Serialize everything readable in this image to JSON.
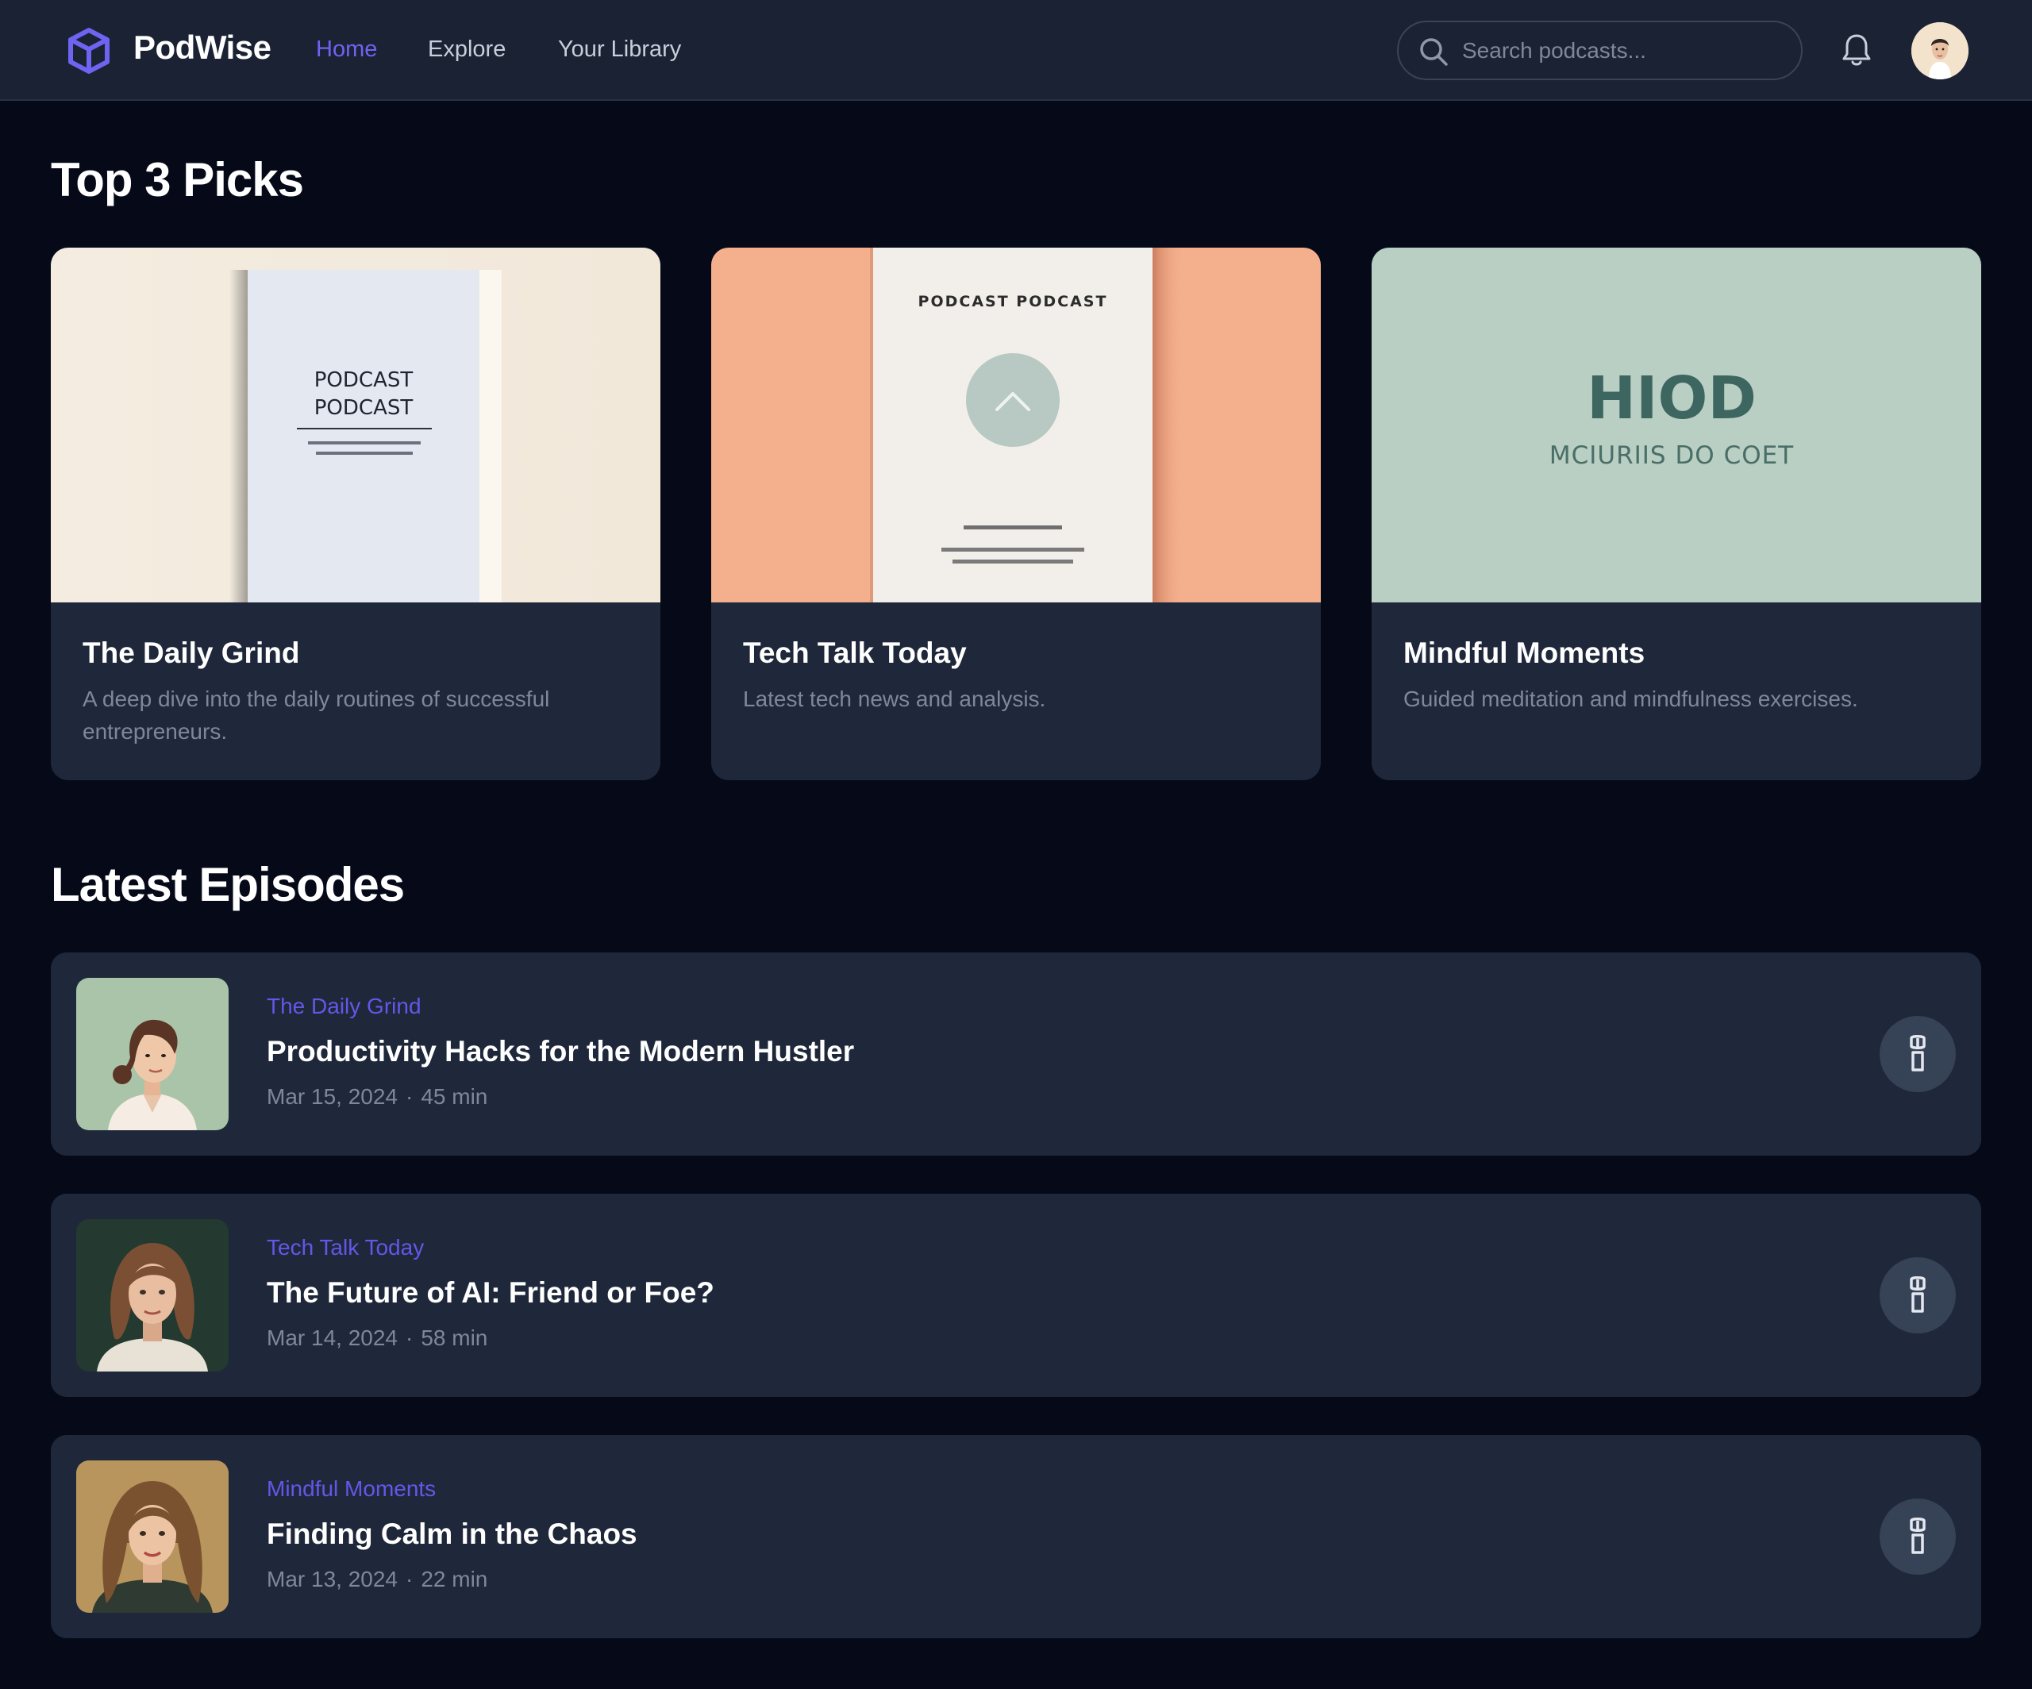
{
  "header": {
    "brand": "PodWise",
    "nav": [
      {
        "label": "Home",
        "active": true
      },
      {
        "label": "Explore",
        "active": false
      },
      {
        "label": "Your Library",
        "active": false
      }
    ],
    "search_placeholder": "Search podcasts...",
    "icons": {
      "logo": "cube-logo-icon",
      "search": "search-icon",
      "notifications": "bell-icon",
      "avatar": "user-avatar"
    },
    "accent_color": "#6f63f2"
  },
  "top_picks": {
    "heading": "Top 3 Picks",
    "items": [
      {
        "title": "The Daily Grind",
        "description": "A deep dive into the daily routines of successful entrepreneurs.",
        "cover_text": [
          "PODCAST",
          "PODCAST"
        ],
        "cover_colors": [
          "#f3eadb",
          "#e4e9f1"
        ]
      },
      {
        "title": "Tech Talk Today",
        "description": "Latest tech news and analysis.",
        "cover_text": [
          "PODCAST PODCAST"
        ],
        "cover_colors": [
          "#f4b08c",
          "#f2efea"
        ]
      },
      {
        "title": "Mindful Moments",
        "description": "Guided meditation and mindfulness exercises.",
        "cover_text": [
          "HIOD",
          "MCIURIIS DO COET"
        ],
        "cover_colors": [
          "#bacfc3",
          "#3e6660"
        ]
      }
    ]
  },
  "latest_episodes": {
    "heading": "Latest Episodes",
    "items": [
      {
        "show": "The Daily Grind",
        "title": "Productivity Hacks for the Modern Hustler",
        "date": "Mar 15, 2024",
        "separator": "·",
        "duration": "45 min",
        "button_icon": "play-icon"
      },
      {
        "show": "Tech Talk Today",
        "title": "The Future of AI: Friend or Foe?",
        "date": "Mar 14, 2024",
        "separator": "·",
        "duration": "58 min",
        "button_icon": "play-icon"
      },
      {
        "show": "Mindful Moments",
        "title": "Finding Calm in the Chaos",
        "date": "Mar 13, 2024",
        "separator": "·",
        "duration": "22 min",
        "button_icon": "play-icon"
      }
    ]
  }
}
